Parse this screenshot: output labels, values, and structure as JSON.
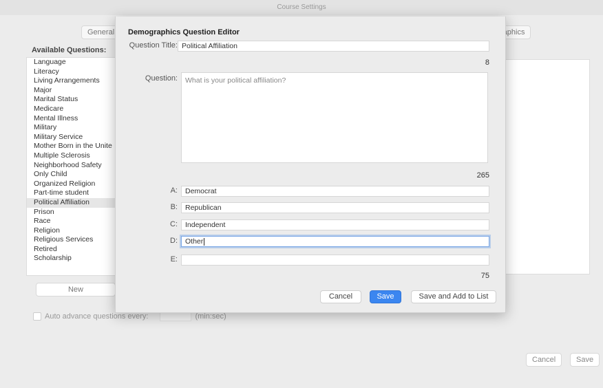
{
  "window": {
    "title": "Course Settings"
  },
  "tabs": {
    "general": "General",
    "demographics": "raphics"
  },
  "available": {
    "label": "Available Questions:",
    "items": [
      "Language",
      "Literacy",
      "Living Arrangements",
      "Major",
      "Marital Status",
      "Medicare",
      "Mental Illness",
      "Military",
      "Military Service",
      "Mother Born in the Unite",
      "Multiple Sclerosis",
      "Neighborhood Safety",
      "Only Child",
      "Organized Religion",
      "Part-time student",
      "Political Affiliation",
      "Prison",
      "Race",
      "Religion",
      "Religious Services",
      "Retired",
      "Scholarship"
    ],
    "selected_index": 15,
    "new_label": "New"
  },
  "auto_advance": {
    "label": "Auto advance questions every:",
    "unit": "(min:sec)"
  },
  "footer": {
    "cancel": "Cancel",
    "save": "Save"
  },
  "editor": {
    "title": "Demographics Question Editor",
    "question_title_label": "Question Title:",
    "question_title_value": "Political Affiliation",
    "title_counter": "8",
    "question_label": "Question:",
    "question_value": "What is your political affiliation?",
    "question_counter": "265",
    "answers": [
      {
        "label": "A:",
        "value": "Democrat"
      },
      {
        "label": "B:",
        "value": "Republican"
      },
      {
        "label": "C:",
        "value": "Independent"
      },
      {
        "label": "D:",
        "value": "Other"
      },
      {
        "label": "E:",
        "value": ""
      }
    ],
    "answers_counter": "75",
    "buttons": {
      "cancel": "Cancel",
      "save": "Save",
      "save_add": "Save and Add to List"
    }
  }
}
